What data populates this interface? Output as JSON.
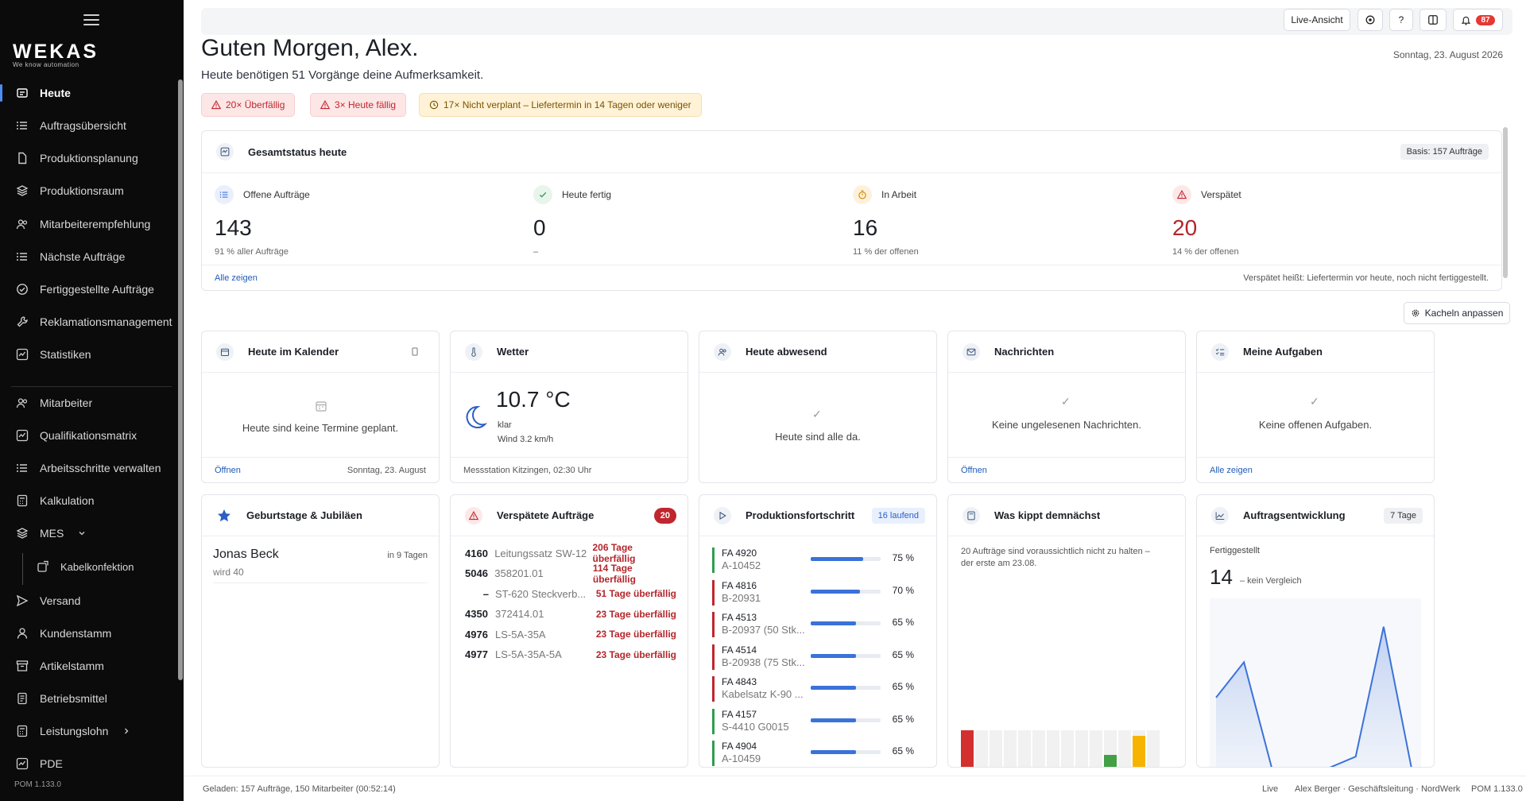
{
  "sidebar": {
    "logo": "WEKAS",
    "logo_sub": "We know automation",
    "items": [
      {
        "label": "Heute",
        "icon": "home-icon"
      },
      {
        "label": "Auftragsübersicht",
        "icon": "list-icon"
      },
      {
        "label": "Produktionsplanung",
        "icon": "document-icon"
      },
      {
        "label": "Produktionsraum",
        "icon": "layers-icon"
      },
      {
        "label": "Mitarbeiterempfehlung",
        "icon": "users-icon"
      },
      {
        "label": "Nächste Aufträge",
        "icon": "list-icon"
      },
      {
        "label": "Fertiggestellte Aufträge",
        "icon": "check-circle-icon"
      },
      {
        "label": "Reklamationsmanagement",
        "icon": "wrench-icon"
      },
      {
        "label": "Statistiken",
        "icon": "chart-icon"
      },
      {
        "label": "Mitarbeiter",
        "icon": "users-icon"
      },
      {
        "label": "Qualifikationsmatrix",
        "icon": "chart-icon"
      },
      {
        "label": "Arbeitsschritte verwalten",
        "icon": "list-icon"
      },
      {
        "label": "Kalkulation",
        "icon": "calculator-icon"
      },
      {
        "label": "MES",
        "icon": "layers-icon"
      },
      {
        "label": "Kabelkonfektion",
        "icon": "cable-icon"
      },
      {
        "label": "Versand",
        "icon": "send-icon"
      },
      {
        "label": "Kundenstamm",
        "icon": "user-icon"
      },
      {
        "label": "Artikelstamm",
        "icon": "archive-icon"
      },
      {
        "label": "Betriebsmittel",
        "icon": "tool-icon"
      },
      {
        "label": "Leistungslohn",
        "icon": "calculator-icon"
      },
      {
        "label": "PDE",
        "icon": "chart-icon"
      }
    ],
    "version": "POM 1.133.0"
  },
  "topbar": {
    "live_label": "Live-Ansicht",
    "help_label": "?",
    "notif_count": "87"
  },
  "header": {
    "greeting": "Guten Morgen, Alex.",
    "subtitle": "Heute benötigen 51 Vorgänge deine Aufmerksamkeit.",
    "date": "Sonntag, 23. August 2026"
  },
  "alerts": [
    {
      "label": "20× Überfällig",
      "tone": "red"
    },
    {
      "label": "3× Heute fällig",
      "tone": "red"
    },
    {
      "label": "17× Nicht verplant – Liefertermin in 14 Tagen oder weniger",
      "tone": "amber"
    }
  ],
  "status": {
    "title": "Gesamtstatus heute",
    "basis": "Basis: 157 Aufträge",
    "stats": [
      {
        "label": "Offene Aufträge",
        "value": "143",
        "sub": "91 % aller Aufträge",
        "color": "#3b72d9"
      },
      {
        "label": "Heute fertig",
        "value": "0",
        "sub": "–",
        "color": "#2e9d4f"
      },
      {
        "label": "In Arbeit",
        "value": "16",
        "sub": "11 % der offenen",
        "color": "#d68a00"
      },
      {
        "label": "Verspätet",
        "value": "20",
        "sub": "14 % der offenen",
        "color": "#c0262d"
      }
    ],
    "link": "Alle zeigen",
    "note": "Verspätet heißt: Liefertermin vor heute, noch nicht fertiggestellt."
  },
  "customize_label": "Kacheln anpassen",
  "tiles": {
    "calendar": {
      "title": "Heute im Kalender",
      "empty": "Heute sind keine Termine geplant.",
      "link": "Öffnen",
      "date": "Sonntag, 23. August"
    },
    "weather": {
      "title": "Wetter",
      "temp": "10.7 °C",
      "cond": "klar",
      "wind": "Wind 3.2 km/h",
      "station": "Messstation Kitzingen, 02:30 Uhr"
    },
    "absent": {
      "title": "Heute abwesend",
      "empty": "Heute sind alle da."
    },
    "messages": {
      "title": "Nachrichten",
      "empty": "Keine ungelesenen Nachrichten.",
      "link": "Öffnen"
    },
    "tasks": {
      "title": "Meine Aufgaben",
      "empty": "Keine offenen Aufgaben.",
      "link": "Alle zeigen"
    },
    "birthdays": {
      "title": "Geburtstage & Jubiläen",
      "name": "Jonas Beck",
      "when": "in 9 Tagen",
      "detail": "wird 40"
    },
    "late": {
      "title": "Verspätete Aufträge",
      "count": "20",
      "rows": [
        {
          "id": "4160",
          "article": "Leitungssatz SW-12",
          "days": "206 Tage überfällig"
        },
        {
          "id": "5046",
          "article": "358201.01",
          "days": "114 Tage überfällig"
        },
        {
          "id": "–",
          "article": "ST-620 Steckverb...",
          "days": "51 Tage überfällig"
        },
        {
          "id": "4350",
          "article": "372414.01",
          "days": "23 Tage überfällig"
        },
        {
          "id": "4976",
          "article": "LS-5A-35A",
          "days": "23 Tage überfällig"
        },
        {
          "id": "4977",
          "article": "LS-5A-35A-5A",
          "days": "23 Tage überfällig"
        }
      ]
    },
    "progress": {
      "title": "Produktionsfortschritt",
      "running": "16 laufend",
      "rows": [
        {
          "fa": "FA 4920",
          "article": "A-10452",
          "pct": "75 %",
          "value": 0.75,
          "color": "#2e9d4f"
        },
        {
          "fa": "FA 4816",
          "article": "B-20931",
          "pct": "70 %",
          "value": 0.7,
          "color": "#c0262d"
        },
        {
          "fa": "FA 4513",
          "article": "B-20937 (50 Stk...",
          "pct": "65 %",
          "value": 0.65,
          "color": "#c0262d"
        },
        {
          "fa": "FA 4514",
          "article": "B-20938 (75 Stk...",
          "pct": "65 %",
          "value": 0.65,
          "color": "#c0262d"
        },
        {
          "fa": "FA 4843",
          "article": "Kabelsatz K-90 ...",
          "pct": "65 %",
          "value": 0.65,
          "color": "#c0262d"
        },
        {
          "fa": "FA 4157",
          "article": "S-4410 G0015",
          "pct": "65 %",
          "value": 0.65,
          "color": "#2e9d4f"
        },
        {
          "fa": "FA 4904",
          "article": "A-10459",
          "pct": "65 %",
          "value": 0.65,
          "color": "#2e9d4f"
        }
      ]
    },
    "tipping": {
      "title": "Was kippt demnächst",
      "text": "20 Aufträge sind voraussichtlich nicht zu halten – der erste am 23.08.",
      "bars": [
        {
          "value": 1.0,
          "color": "#d32f2f"
        },
        {
          "value": 0,
          "color": "#eeeeee"
        },
        {
          "value": 0,
          "color": "#eeeeee"
        },
        {
          "value": 0,
          "color": "#eeeeee"
        },
        {
          "value": 0,
          "color": "#eeeeee"
        },
        {
          "value": 0,
          "color": "#eeeeee"
        },
        {
          "value": 0,
          "color": "#eeeeee"
        },
        {
          "value": 0,
          "color": "#eeeeee"
        },
        {
          "value": 0,
          "color": "#eeeeee"
        },
        {
          "value": 0,
          "color": "#eeeeee"
        },
        {
          "value": 0.35,
          "color": "#43a047"
        },
        {
          "value": 0,
          "color": "#eeeeee"
        },
        {
          "value": 0.85,
          "color": "#f6b400"
        },
        {
          "value": 0,
          "color": "#eeeeee"
        }
      ]
    },
    "trend": {
      "title": "Auftragsentwicklung",
      "range": "7 Tage",
      "label": "Fertiggestellt",
      "value": "14",
      "compare": "– kein Vergleich"
    }
  },
  "chart_data": {
    "type": "area",
    "title": "",
    "xlabel": "",
    "ylabel": "",
    "values": [
      3,
      4.5,
      0,
      0,
      0,
      0.5,
      6,
      0
    ],
    "ylim": [
      0,
      7
    ]
  },
  "statusbar": {
    "left": "Geladen: 157 Aufträge, 150 Mitarbeiter (00:52:14)",
    "live": "Live",
    "user": "Alex Berger · Geschäftsleitung · NordWerk",
    "version": "POM 1.133.0"
  }
}
